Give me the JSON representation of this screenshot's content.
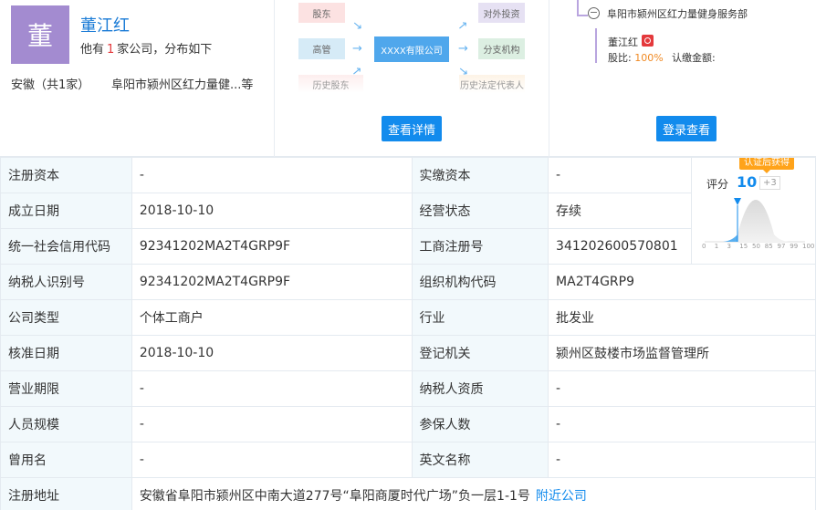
{
  "person": {
    "avatar_char": "董",
    "name": "董江红",
    "desc_prefix": "他有",
    "company_count": "1",
    "desc_suffix": "家公司，分布如下",
    "region": "安徽（共1家）",
    "company_short": "阜阳市颍州区红力量健...等"
  },
  "diagram": {
    "shareholder": "股东",
    "executive": "高管",
    "center": "XXXX有限公司",
    "investment": "对外投资",
    "branch": "分支机构",
    "history_shareholder": "历史股东",
    "history_legal": "历史法定代表人",
    "details_button": "查看详情"
  },
  "tree": {
    "company": "阜阳市颍州区红力量健身服务部",
    "person": "董江红",
    "share_label": "股比:",
    "share_value": "100%",
    "paid_label": "认缴金额:",
    "login_button": "登录查看"
  },
  "score": {
    "tag": "认证后获得",
    "label": "评分",
    "value": "10",
    "delta": "+3",
    "ticks": [
      "0",
      "1",
      "3",
      "15",
      "50",
      "85",
      "97",
      "99",
      "100"
    ]
  },
  "rows": [
    {
      "l1": "注册资本",
      "v1": "-",
      "l2": "实缴资本",
      "v2": "-"
    },
    {
      "l1": "成立日期",
      "v1": "2018-10-10",
      "l2": "经营状态",
      "v2": "存续"
    },
    {
      "l1": "统一社会信用代码",
      "v1": "92341202MA2T4GRP9F",
      "l2": "工商注册号",
      "v2": "341202600570801"
    },
    {
      "l1": "纳税人识别号",
      "v1": "92341202MA2T4GRP9F",
      "l2": "组织机构代码",
      "v2": "MA2T4GRP9"
    },
    {
      "l1": "公司类型",
      "v1": "个体工商户",
      "l2": "行业",
      "v2": "批发业"
    },
    {
      "l1": "核准日期",
      "v1": "2018-10-10",
      "l2": "登记机关",
      "v2": "颍州区鼓楼市场监督管理所"
    },
    {
      "l1": "营业期限",
      "v1": "-",
      "l2": "纳税人资质",
      "v2": "-"
    },
    {
      "l1": "人员规模",
      "v1": "-",
      "l2": "参保人数",
      "v2": "-"
    },
    {
      "l1": "曾用名",
      "v1": "-",
      "l2": "英文名称",
      "v2": "-"
    }
  ],
  "address": {
    "label": "注册地址",
    "value": "安徽省阜阳市颍州区中南大道277号“阜阳商厦时代广场”负一层1-1号",
    "nearby_link": "附近公司"
  }
}
